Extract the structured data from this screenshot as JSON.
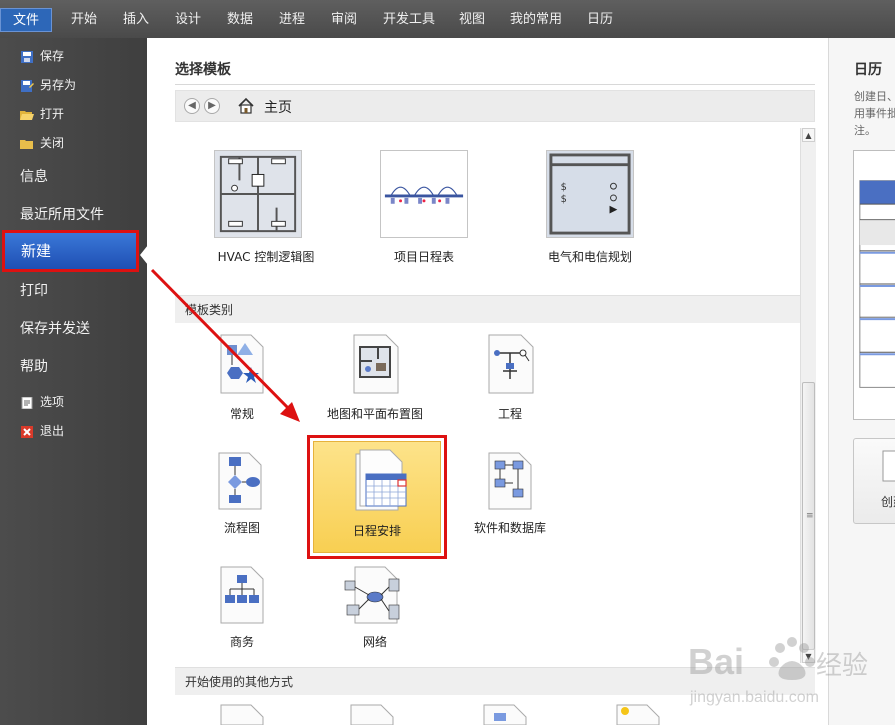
{
  "ribbon": {
    "tabs": [
      "文件",
      "开始",
      "插入",
      "设计",
      "数据",
      "进程",
      "审阅",
      "开发工具",
      "视图",
      "我的常用",
      "日历"
    ]
  },
  "nav": {
    "save": "保存",
    "save_as": "另存为",
    "open": "打开",
    "close": "关闭",
    "info": "信息",
    "recent": "最近所用文件",
    "new": "新建",
    "print": "打印",
    "save_send": "保存并发送",
    "help": "帮助",
    "options": "选项",
    "exit": "退出"
  },
  "center": {
    "title": "选择模板",
    "breadcrumb_home": "主页",
    "templates_recent": [
      "HVAC 控制逻辑图",
      "项目日程表",
      "电气和电信规划"
    ],
    "category_header": "模板类别",
    "categories": [
      "常规",
      "地图和平面布置图",
      "工程",
      "流程图",
      "日程安排",
      "软件和数据库",
      "商务",
      "网络"
    ],
    "selected_category": "日程安排",
    "other_ways_header": "开始使用的其他方式"
  },
  "right": {
    "title": "日历",
    "description": "创建日、使用事件批注。",
    "create_label": "创建"
  },
  "watermark": {
    "brand": "Bai",
    "brand_cn": "经验",
    "url": "jingyan.baidu.com"
  },
  "colors": {
    "ribbon_bg": "#4f4f4f",
    "file_tab": "#2d67b8",
    "nav_bg": "#454545",
    "selected_tile": "#fbd662",
    "highlight_red": "#dd1111"
  }
}
